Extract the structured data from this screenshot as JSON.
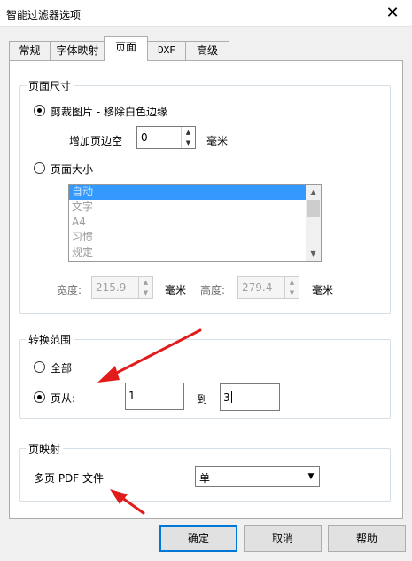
{
  "window": {
    "title": "智能过滤器选项",
    "close_glyph": "✕"
  },
  "tabs": [
    {
      "label": "常规"
    },
    {
      "label": "字体映射"
    },
    {
      "label": "页面",
      "active": true
    },
    {
      "label": "DXF"
    },
    {
      "label": "高级"
    }
  ],
  "page_size": {
    "group_title": "页面尺寸",
    "crop_option": "剪裁图片 - 移除白色边缘",
    "crop_checked": true,
    "add_margin_label": "增加页边空",
    "add_margin_value": "0",
    "add_margin_unit": "毫米",
    "page_size_option": "页面大小",
    "page_size_checked": false,
    "list_items": [
      "自动",
      "文字",
      "A4",
      "习惯",
      "规定"
    ],
    "selected_index": 0,
    "width_label": "宽度:",
    "width_value": "215.9",
    "width_unit": "毫米",
    "height_label": "高度:",
    "height_value": "279.4",
    "height_unit": "毫米"
  },
  "convert_range": {
    "group_title": "转换范围",
    "all_option": "全部",
    "all_checked": false,
    "pages_option": "页从:",
    "pages_checked": true,
    "from_value": "1",
    "to_label": "到",
    "to_value": "3"
  },
  "page_mapping": {
    "group_title": "页映射",
    "label": "多页 PDF 文件",
    "selected": "单一"
  },
  "buttons": {
    "ok": "确定",
    "cancel": "取消",
    "help": "帮助"
  },
  "colors": {
    "annotation_arrow": "#e21b1b",
    "selection": "#3399ff",
    "focus_border": "#0078d7"
  }
}
